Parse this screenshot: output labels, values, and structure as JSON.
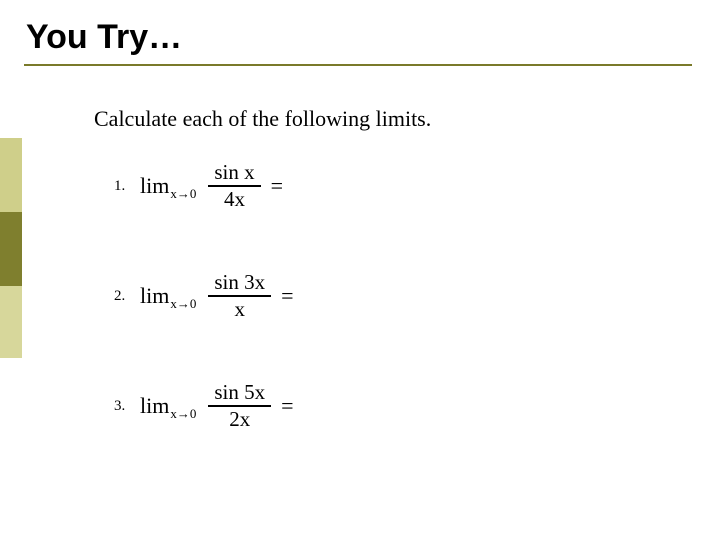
{
  "title": "You Try…",
  "instruction": "Calculate each of the following limits.",
  "limit_label": "lim",
  "limit_subscript": "x→0",
  "equals": "=",
  "problems": [
    {
      "number": "1.",
      "numerator": "sin x",
      "denominator": "4x"
    },
    {
      "number": "2.",
      "numerator": "sin 3x",
      "denominator": "x"
    },
    {
      "number": "3.",
      "numerator": "sin 5x",
      "denominator": "2x"
    }
  ]
}
